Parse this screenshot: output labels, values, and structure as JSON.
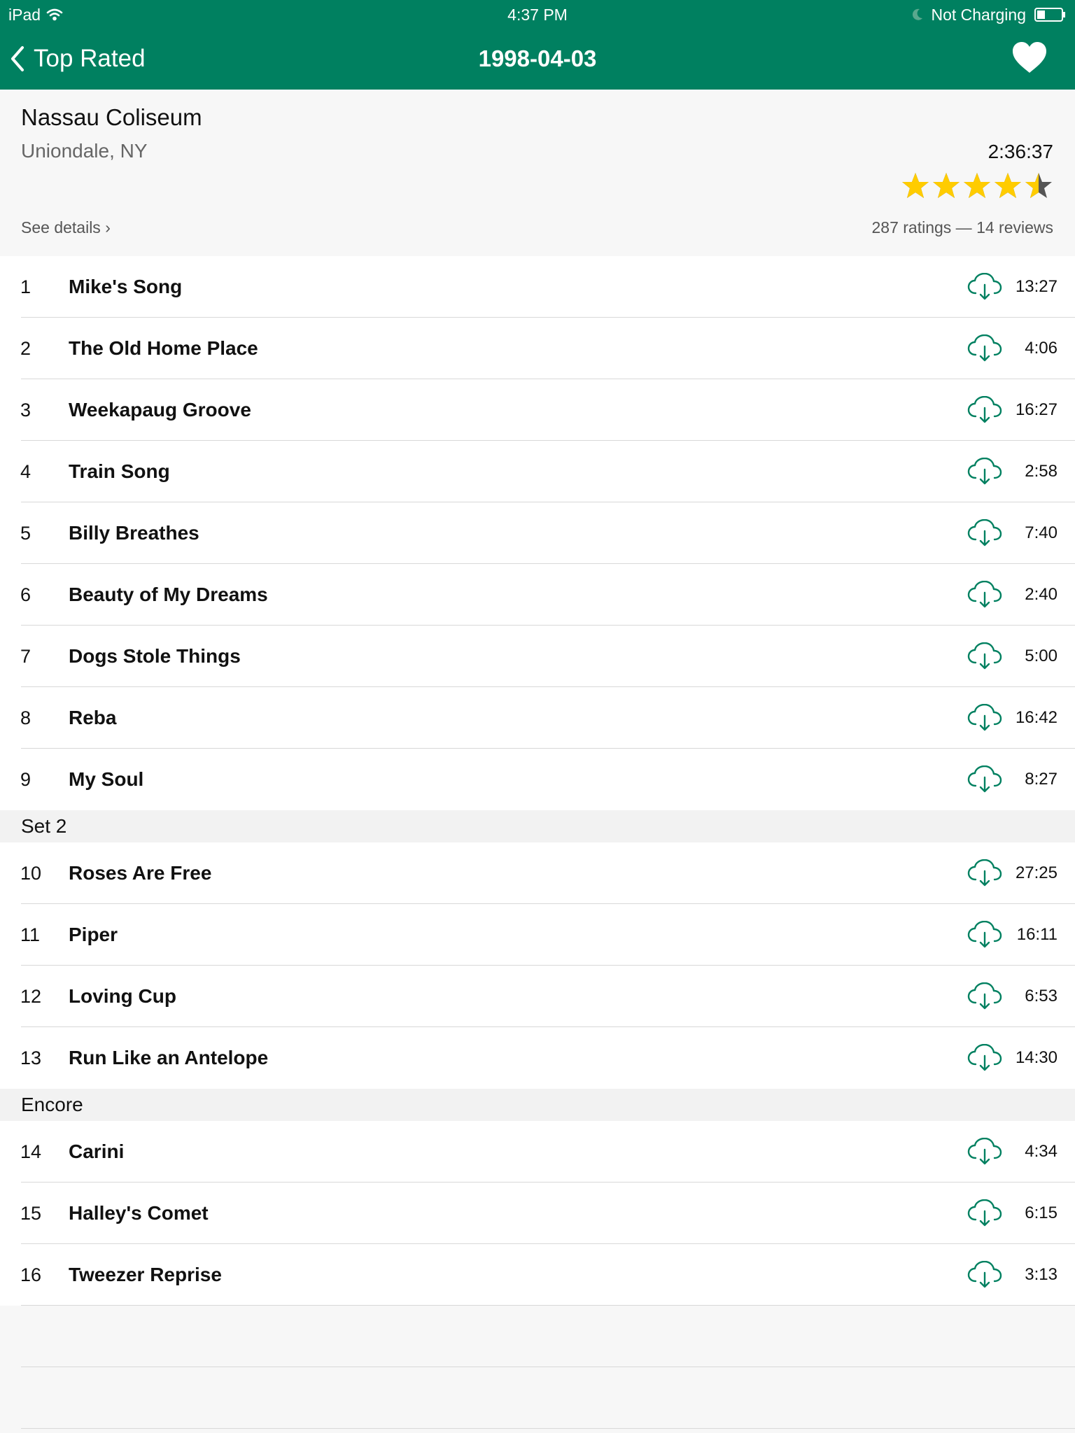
{
  "status_bar": {
    "device": "iPad",
    "time": "4:37 PM",
    "battery_status": "Not Charging"
  },
  "nav": {
    "back_label": "Top Rated",
    "title": "1998-04-03"
  },
  "show": {
    "venue": "Nassau Coliseum",
    "location": "Uniondale, NY",
    "duration": "2:36:37",
    "rating_stars": 4.5,
    "details_link": "See details ›",
    "ratings_summary": "287 ratings — 14 reviews"
  },
  "sets": [
    {
      "header": "",
      "tracks": [
        {
          "num": "1",
          "title": "Mike's Song",
          "time": "13:27"
        },
        {
          "num": "2",
          "title": "The Old Home Place",
          "time": "4:06"
        },
        {
          "num": "3",
          "title": "Weekapaug Groove",
          "time": "16:27"
        },
        {
          "num": "4",
          "title": "Train Song",
          "time": "2:58"
        },
        {
          "num": "5",
          "title": "Billy Breathes",
          "time": "7:40"
        },
        {
          "num": "6",
          "title": "Beauty of My Dreams",
          "time": "2:40"
        },
        {
          "num": "7",
          "title": "Dogs Stole Things",
          "time": "5:00"
        },
        {
          "num": "8",
          "title": "Reba",
          "time": "16:42"
        },
        {
          "num": "9",
          "title": "My Soul",
          "time": "8:27"
        }
      ]
    },
    {
      "header": "Set 2",
      "tracks": [
        {
          "num": "10",
          "title": "Roses Are Free",
          "time": "27:25"
        },
        {
          "num": "11",
          "title": "Piper",
          "time": "16:11"
        },
        {
          "num": "12",
          "title": "Loving Cup",
          "time": "6:53"
        },
        {
          "num": "13",
          "title": "Run Like an Antelope",
          "time": "14:30"
        }
      ]
    },
    {
      "header": "Encore",
      "tracks": [
        {
          "num": "14",
          "title": "Carini",
          "time": "4:34"
        },
        {
          "num": "15",
          "title": "Halley's Comet",
          "time": "6:15"
        },
        {
          "num": "16",
          "title": "Tweezer Reprise",
          "time": "3:13"
        }
      ]
    }
  ],
  "icons": {
    "wifi": "wifi-icon",
    "moon": "moon-icon",
    "battery": "battery-icon",
    "back": "chevron-left-icon",
    "favorite": "heart-icon",
    "star": "star-icon",
    "download": "cloud-download-icon"
  },
  "colors": {
    "nav_background": "#008060",
    "accent": "#008060",
    "star": "#FFCC00",
    "star_empty": "#555555"
  }
}
